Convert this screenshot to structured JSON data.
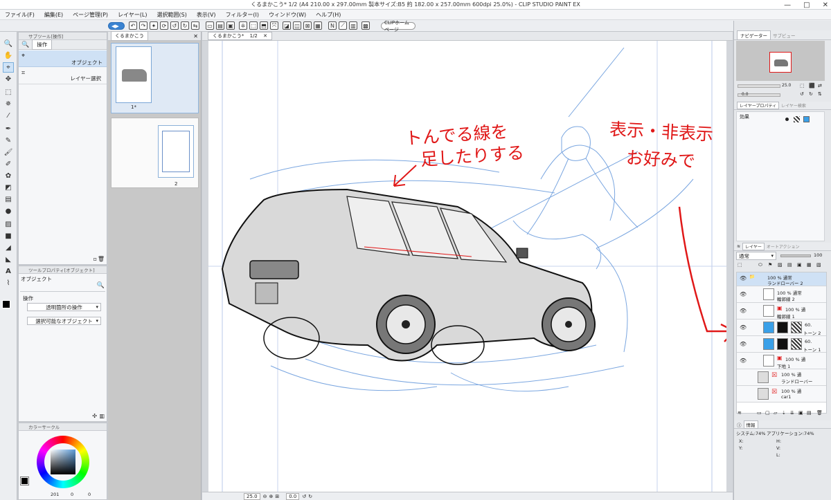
{
  "window": {
    "title": "くるまかこう* 1/2 (A4 210.00 x 297.00mm 製本サイズ:B5 約 182.00 x 257.00mm 600dpi 25.0%) - CLIP STUDIO PAINT EX",
    "minimize": "—",
    "maximize": "□",
    "close": "✕"
  },
  "menu": [
    "ファイル(F)",
    "編集(E)",
    "ページ管理(P)",
    "レイヤー(L)",
    "選択範囲(S)",
    "表示(V)",
    "フィルター(I)",
    "ウィンドウ(W)",
    "ヘルプ(H)"
  ],
  "command_bar": {
    "clip_home": "CLIPホームページ"
  },
  "subtool_panel": {
    "tab": "サブツール[操作]",
    "group": "操作",
    "items": [
      "オブジェクト",
      "レイヤー選択"
    ]
  },
  "tool_property": {
    "tab": "ツールプロパティ[オブジェクト]",
    "name": "オブジェクト",
    "section": "操作",
    "dropdown1": "透明箇所の操作",
    "dropdown2": "選択可能なオブジェクト"
  },
  "color_panel": {
    "tab": "カラーサークル",
    "value1": "201",
    "value2": "0",
    "value3": "0"
  },
  "page_manager": {
    "tab": "くるまかこう",
    "pages": [
      {
        "label": "1*"
      },
      {
        "label": "2"
      }
    ]
  },
  "canvas": {
    "tab": "くるまかこう*",
    "tab_page": "1/2",
    "annotation_left": [
      "トんでる線を",
      "足したりする"
    ],
    "annotation_right": [
      "表示・非表示",
      "お好みで"
    ],
    "zoom": "25.0",
    "rotation": "0.0",
    "colors": {
      "annotation": "#e01818",
      "sketch": "#7aa6e0"
    }
  },
  "navigator": {
    "tab1": "ナビゲーター",
    "tab2": "サブビュー",
    "zoom": "25.0",
    "rotation": "0.0"
  },
  "layer_property": {
    "tab1": "レイヤープロパティ",
    "tab2": "レイヤー検索",
    "effect_label": "効果"
  },
  "layers_panel": {
    "tab1": "レイヤー",
    "tab2": "オートアクション",
    "blend_mode": "通常",
    "opacity": "100",
    "rows": [
      {
        "line1": "100 % 通常",
        "line2": "ランドローバー 2",
        "type": "folder"
      },
      {
        "line1": "100 % 通常",
        "line2": "輪郭線 2",
        "type": "raster"
      },
      {
        "line1": "100 % 通",
        "line2": "輪郭線 1",
        "type": "raster"
      },
      {
        "line1": "60.",
        "line2": "トーン 2",
        "type": "tone"
      },
      {
        "line1": "60.",
        "line2": "トーン 1",
        "type": "tone"
      },
      {
        "line1": "100 % 通",
        "line2": "下地 1",
        "type": "raster"
      },
      {
        "line1": "100 % 通",
        "line2": "ランドローバー",
        "type": "3d"
      },
      {
        "line1": "100 % 通",
        "line2": "car1",
        "type": "3d"
      }
    ]
  },
  "info_panel": {
    "tab": "情報",
    "system": "システム:74%",
    "application": "アプリケーション:74%",
    "x_label": "X:",
    "y_label": "Y:",
    "h_label": "H:",
    "v_label": "V:",
    "l_label": "L:"
  }
}
